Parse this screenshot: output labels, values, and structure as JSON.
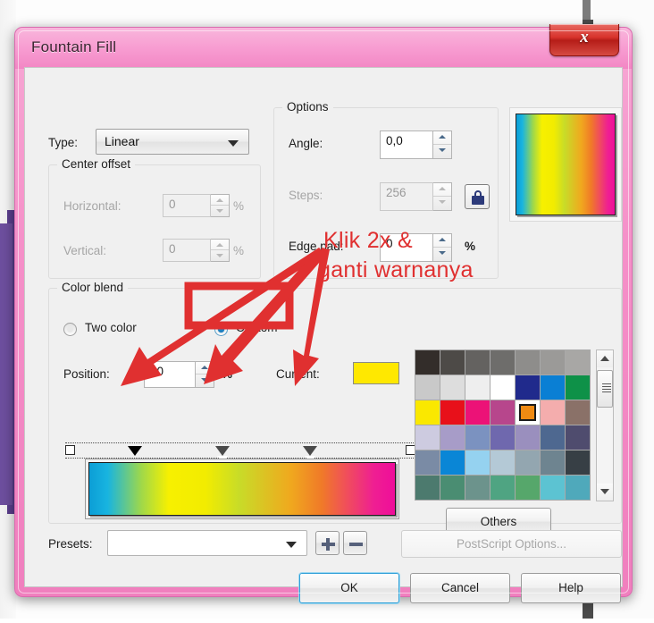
{
  "window": {
    "title": "Fountain Fill",
    "close_label": "x"
  },
  "type_row": {
    "label": "Type:",
    "value": "Linear"
  },
  "center_offset": {
    "group_title": "Center offset",
    "horizontal_label": "Horizontal:",
    "horizontal_value": "0",
    "horizontal_unit": "%",
    "vertical_label": "Vertical:",
    "vertical_value": "0",
    "vertical_unit": "%"
  },
  "options": {
    "group_title": "Options",
    "angle_label": "Angle:",
    "angle_value": "0,0",
    "steps_label": "Steps:",
    "steps_value": "256",
    "edge_pad_label": "Edge pad:",
    "edge_pad_value": "0",
    "edge_pad_unit": "%",
    "lock_icon": "lock-icon"
  },
  "color_blend": {
    "group_title": "Color blend",
    "two_color_label": "Two color",
    "custom_label": "Custom",
    "selected": "Custom",
    "position_label": "Position:",
    "position_value": "20",
    "position_unit": "%",
    "current_label": "Current:",
    "current_color": "#FFE800",
    "others_label": "Others"
  },
  "gradient": {
    "stops": [
      "#0aa0d8",
      "#f5f000",
      "#e8e000",
      "#b8d820",
      "#f0a020",
      "#f07028",
      "#ef0d9a"
    ],
    "css": "linear-gradient(to right,#0c9ed6 0%,#18b4e0 6%,#9fd84a 17%,#f7f000 26%,#f2ec00 38%,#c8dc28 49%,#f0a81e 66%,#f07a28 76%,#ef1f92 93%,#ef0d9a 100%)",
    "markers": [
      {
        "name": "start-square",
        "type": "square",
        "position_pct": 0
      },
      {
        "name": "stop-marker-selected",
        "type": "triangle-filled",
        "position_pct": 20
      },
      {
        "name": "stop-marker-2",
        "type": "triangle-hollow",
        "position_pct": 45
      },
      {
        "name": "stop-marker-3",
        "type": "triangle-hollow",
        "position_pct": 70
      },
      {
        "name": "end-square",
        "type": "square",
        "position_pct": 100
      }
    ]
  },
  "palette": {
    "selected_index": 18,
    "colors": [
      "#332d2a",
      "#4d4a47",
      "#646260",
      "#6e6d6b",
      "#8e8d8b",
      "#9b9a98",
      "#a8a7a5",
      "#c9c9c9",
      "#dddddd",
      "#eeeeee",
      "#ffffff",
      "#202a8c",
      "#0a7fd4",
      "#0e9148",
      "#fae800",
      "#e8101a",
      "#ec1277",
      "#b7468c",
      "#ef8a12",
      "#f4adad",
      "#8a7168",
      "#cdcbe0",
      "#a79cc8",
      "#7b92c0",
      "#6f68ae",
      "#9a8fbe",
      "#4e6890",
      "#4f4c6e",
      "#7a8ba5",
      "#0a86d6",
      "#95d2f0",
      "#b4c9d6",
      "#93a6b0",
      "#6e8490",
      "#373f45",
      "#4c7a6e",
      "#4a8d72",
      "#6c938c",
      "#4fa482",
      "#56a76b",
      "#5cc3d2",
      "#4fa9bb"
    ]
  },
  "presets": {
    "label": "Presets:",
    "value": "",
    "add_label": "add-preset",
    "remove_label": "remove-preset",
    "postscript_label": "PostScript Options..."
  },
  "footer": {
    "ok_label": "OK",
    "cancel_label": "Cancel",
    "help_label": "Help"
  },
  "annotations": {
    "line1": "Klik 2x &",
    "line2": "ganti warnanya",
    "color": "#e03030"
  }
}
